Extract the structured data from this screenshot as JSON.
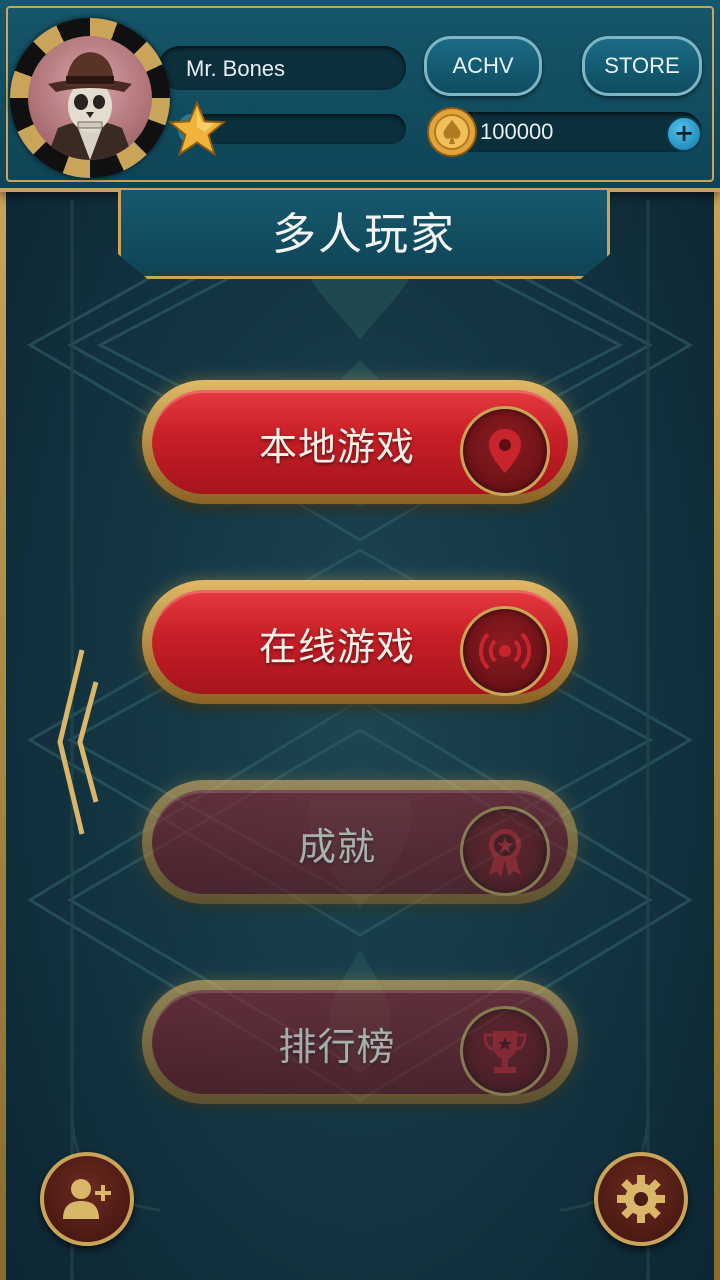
{
  "player": {
    "name": "Mr. Bones",
    "xp_progress": 0.12,
    "coins": "100000"
  },
  "header": {
    "achv_label": "ACHV",
    "store_label": "STORE",
    "add_coins_label": "+"
  },
  "page": {
    "title": "多人玩家"
  },
  "menu": {
    "items": [
      {
        "label": "本地游戏",
        "icon": "location-pin-icon",
        "enabled": true
      },
      {
        "label": "在线游戏",
        "icon": "broadcast-icon",
        "enabled": true
      },
      {
        "label": "成就",
        "icon": "award-ribbon-icon",
        "enabled": false
      },
      {
        "label": "排行榜",
        "icon": "trophy-icon",
        "enabled": false
      }
    ]
  },
  "colors": {
    "gold": "#c9a459",
    "teal_header": "#16566b",
    "button_red": "#c71f27",
    "background": "#143643"
  },
  "icons": {
    "back": "chevron-left-icon",
    "add_friend": "add-friend-icon",
    "settings": "gear-icon"
  }
}
